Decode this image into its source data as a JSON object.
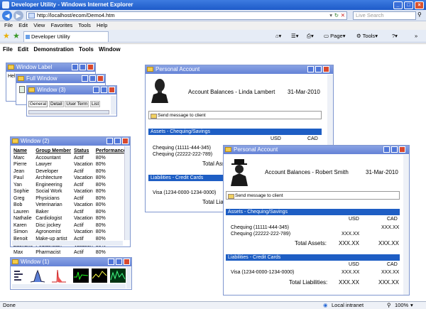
{
  "browser": {
    "title": "Developer Utility - Windows Internet Explorer",
    "address": "http://localhost/ecom/Demo4.htm",
    "search_placeholder": "Live Search",
    "menu": [
      "File",
      "Edit",
      "View",
      "Favorites",
      "Tools",
      "Help"
    ],
    "tab_label": "Developer Utility",
    "toolbar": {
      "page": "Page",
      "tools": "Tools"
    },
    "status": {
      "left": "Done",
      "zone": "Local intranet",
      "zoom": "100%"
    }
  },
  "app": {
    "menu": [
      "File",
      "Edit",
      "Demonstration",
      "Tools",
      "Window"
    ]
  },
  "window_label": {
    "title": "Window Label",
    "text": "Hel"
  },
  "full_window": {
    "title": "Full Window"
  },
  "window3": {
    "title": "Window (3)",
    "tabs": [
      "General",
      "Detail",
      "User Term",
      "List"
    ]
  },
  "window2": {
    "title": "Window (2)",
    "headers": [
      "Name",
      "Group Member",
      "Status",
      "Performance"
    ],
    "rows": [
      [
        "Marc",
        "Accountant",
        "Actif",
        "80%"
      ],
      [
        "Pierre",
        "Lawyer",
        "Vacation",
        "80%"
      ],
      [
        "Jean",
        "Developer",
        "Actif",
        "80%"
      ],
      [
        "Paul",
        "Architecture",
        "Vacation",
        "80%"
      ],
      [
        "Yan",
        "Engineering",
        "Actif",
        "80%"
      ],
      [
        "Sophie",
        "Social Work",
        "Vacation",
        "80%"
      ],
      [
        "Greg",
        "Physicians",
        "Actif",
        "80%"
      ],
      [
        "Bob",
        "Veterinarian",
        "Vacation",
        "80%"
      ],
      [
        "Lauren",
        "Baker",
        "Actif",
        "80%"
      ],
      [
        "Nathalie",
        "Cardiologist",
        "Vacation",
        "80%"
      ],
      [
        "Karen",
        "Disc jockey",
        "Actif",
        "80%"
      ],
      [
        "Simon",
        "Agronomist",
        "Vacation",
        "80%"
      ],
      [
        "Benoit",
        "Make-up artist",
        "Actif",
        "80%"
      ],
      [
        "Zacharie",
        "Pediatrician",
        "Vacation",
        "80%"
      ],
      [
        "Max",
        "Pharmacist",
        "Actif",
        "80%"
      ]
    ]
  },
  "window1": {
    "title": "Window (1)"
  },
  "account1": {
    "title": "Personal Account",
    "heading": "Account Balances - Linda Lambert",
    "date": "31-Mar-2010",
    "send_message": "Send message to client",
    "assets_title": "Assets - Chequing/Savings",
    "col_usd": "USD",
    "col_cad": "CAD",
    "assets": [
      "Chequing (11111-444-345)",
      "Chequing (22222-222-789)"
    ],
    "total_assets_label": "Total Asse",
    "liabilities_title": "Liabilities - Credit Cards",
    "liabilities": [
      "Visa (1234-0000-1234-0000)"
    ],
    "total_liabilities_label": "Total Liabili"
  },
  "account2": {
    "title": "Personal Account",
    "heading": "Account Balances - Robert Smith",
    "date": "31-Mar-2010",
    "send_message": "Send message to client",
    "assets_title": "Assets - Chequing/Savings",
    "col_usd": "USD",
    "col_cad": "CAD",
    "assets": [
      {
        "name": "Chequing (11111-444-345)",
        "usd": "",
        "cad": "XXX.XX"
      },
      {
        "name": "Chequing (22222-222-789)",
        "usd": "XXX.XX",
        "cad": ""
      }
    ],
    "total_assets_label": "Total Assets:",
    "total_assets_usd": "XXX.XX",
    "total_assets_cad": "XXX.XX",
    "liabilities_title": "Liabilities - Credit Cards",
    "liabilities": [
      {
        "name": "Visa (1234-0000-1234-0000)",
        "usd": "XXX.XX",
        "cad": "XXX.XX"
      }
    ],
    "total_liabilities_label": "Total Liabilities:",
    "total_liabilities_usd": "XXX.XX",
    "total_liabilities_cad": "XXX.XX"
  }
}
